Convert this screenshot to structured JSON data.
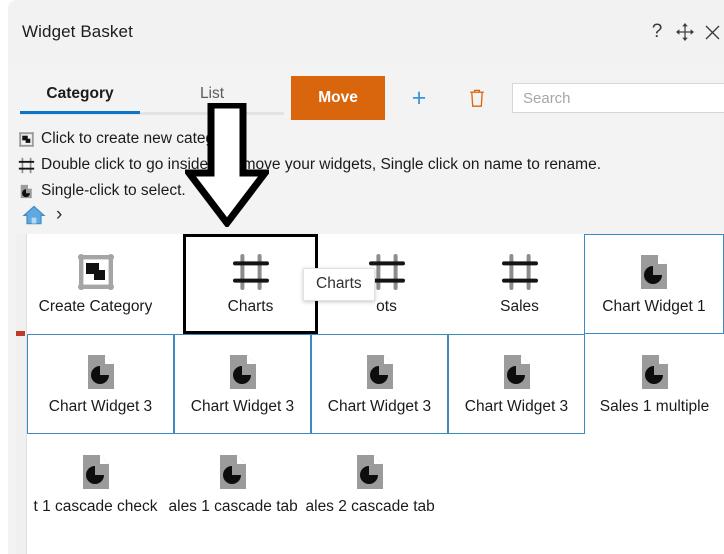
{
  "window": {
    "title": "Widget Basket",
    "controls": [
      {
        "name": "help-button",
        "glyph": "?"
      },
      {
        "name": "move-window-button",
        "glyph": "move"
      },
      {
        "name": "close-button",
        "glyph": "close"
      }
    ]
  },
  "tabs": {
    "items": [
      {
        "label": "Category",
        "active": true
      },
      {
        "label": "List",
        "active": false
      }
    ],
    "accent_color": "#0b75c9"
  },
  "toolbar": {
    "move_label": "Move",
    "move_color": "#d9650d",
    "add_label": "+",
    "add_color": "#3f93d8",
    "delete_name": "trash-icon",
    "delete_color": "#d9650d"
  },
  "search": {
    "placeholder": "Search",
    "value": ""
  },
  "hints": [
    {
      "icon": "create-category-icon",
      "text": "Click to create new category."
    },
    {
      "icon": "charts-frame-icon",
      "text": "Double click to go inside and move your widgets, Single click on name to rename."
    },
    {
      "icon": "chart-document-icon",
      "text": "Single-click to select."
    }
  ],
  "breadcrumb": {
    "home_icon": "home-icon",
    "separator": "›"
  },
  "tooltip": {
    "text": "Charts"
  },
  "grid": {
    "selection_color": "#3b8ac4",
    "highlight_color": "#000000",
    "rows": [
      {
        "tiles": [
          {
            "label": "Create Category",
            "icon": "create-category-icon",
            "state": "normal"
          },
          {
            "label": "Charts",
            "icon": "charts-frame-icon",
            "state": "highlighted"
          },
          {
            "label": "ots",
            "icon": "charts-frame-icon",
            "state": "normal"
          },
          {
            "label": "Sales",
            "icon": "charts-frame-icon",
            "state": "normal"
          },
          {
            "label": "Chart Widget 1",
            "icon": "chart-document-icon",
            "state": "selected"
          }
        ]
      },
      {
        "tiles": [
          {
            "label": "Chart Widget 3",
            "icon": "chart-document-icon",
            "state": "selected"
          },
          {
            "label": "Chart Widget 3",
            "icon": "chart-document-icon",
            "state": "selected"
          },
          {
            "label": "Chart Widget 3",
            "icon": "chart-document-icon",
            "state": "selected"
          },
          {
            "label": "Chart Widget 3",
            "icon": "chart-document-icon",
            "state": "selected"
          },
          {
            "label": "Sales 1 multiple",
            "icon": "chart-document-icon",
            "state": "normal"
          }
        ]
      },
      {
        "tiles": [
          {
            "label": "t 1 cascade check",
            "icon": "chart-document-icon",
            "state": "normal"
          },
          {
            "label": "ales 1 cascade tab",
            "icon": "chart-document-icon",
            "state": "normal"
          },
          {
            "label": "ales 2 cascade tab",
            "icon": "chart-document-icon",
            "state": "normal"
          }
        ]
      }
    ]
  },
  "annotation": {
    "arrow": "down-arrow-annotation"
  }
}
